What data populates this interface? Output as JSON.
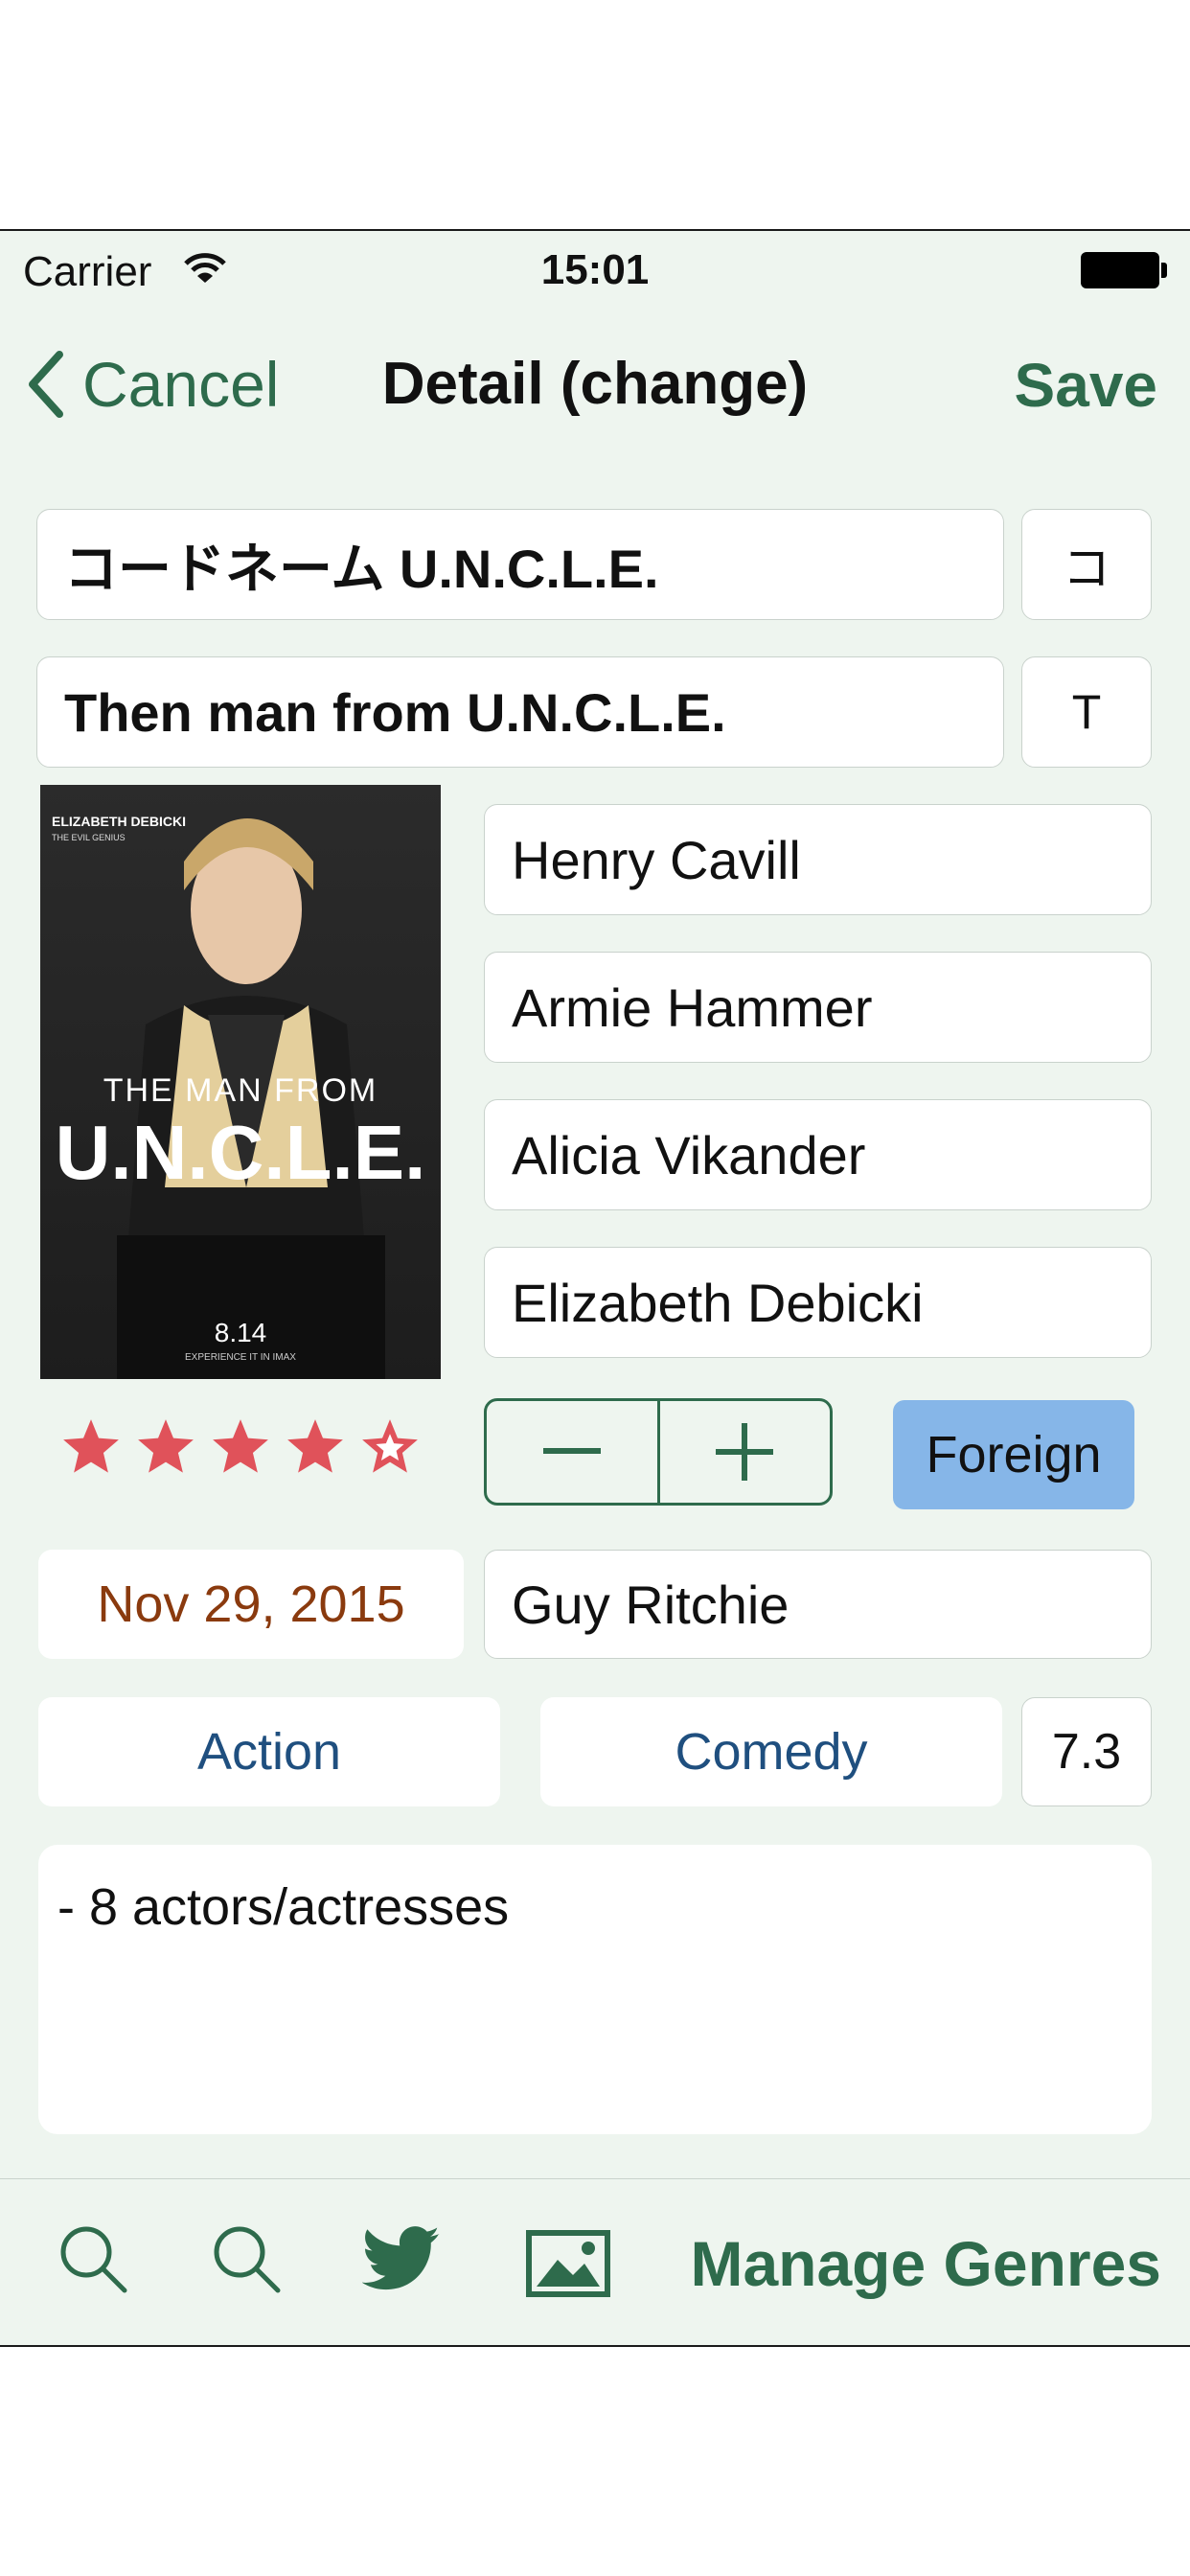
{
  "status_bar": {
    "carrier": "Carrier",
    "time": "15:01"
  },
  "nav": {
    "back_label": "Cancel",
    "title": "Detail (change)",
    "save_label": "Save"
  },
  "title_ja": {
    "value": "コードネーム U.N.C.L.E.",
    "index_key": "コ"
  },
  "title_en": {
    "value": "Then man from U.N.C.L.E.",
    "index_key": "T"
  },
  "poster": {
    "top_credit": "ELIZABETH DEBICKI",
    "top_sub": "THE EVIL GENIUS",
    "line1": "THE MAN FROM",
    "line2": "U.N.C.L.E.",
    "date": "8.14",
    "tagline": "EXPERIENCE IT IN IMAX"
  },
  "cast": [
    "Henry Cavill",
    "Armie Hammer",
    "Alicia Vikander",
    "Elizabeth Debicki"
  ],
  "rating": {
    "stars": 4.5,
    "max": 5,
    "color": "#e0525a"
  },
  "stepper": {
    "minus_icon": "minus-icon",
    "plus_icon": "plus-icon"
  },
  "foreign_button": {
    "label": "Foreign",
    "color": "#86b6e8"
  },
  "date": "Nov 29, 2015",
  "director": "Guy Ritchie",
  "genres": [
    "Action",
    "Comedy"
  ],
  "score": "7.3",
  "note": "- 8 actors/actresses",
  "toolbar": {
    "icons": [
      "search-icon",
      "search-icon",
      "twitter-icon",
      "image-icon"
    ],
    "manage_label": "Manage Genres"
  },
  "colors": {
    "accent": "#2e6b4c",
    "background": "#eef5ef",
    "date_text": "#8a3a0e",
    "genre_text": "#1f4f7f"
  }
}
